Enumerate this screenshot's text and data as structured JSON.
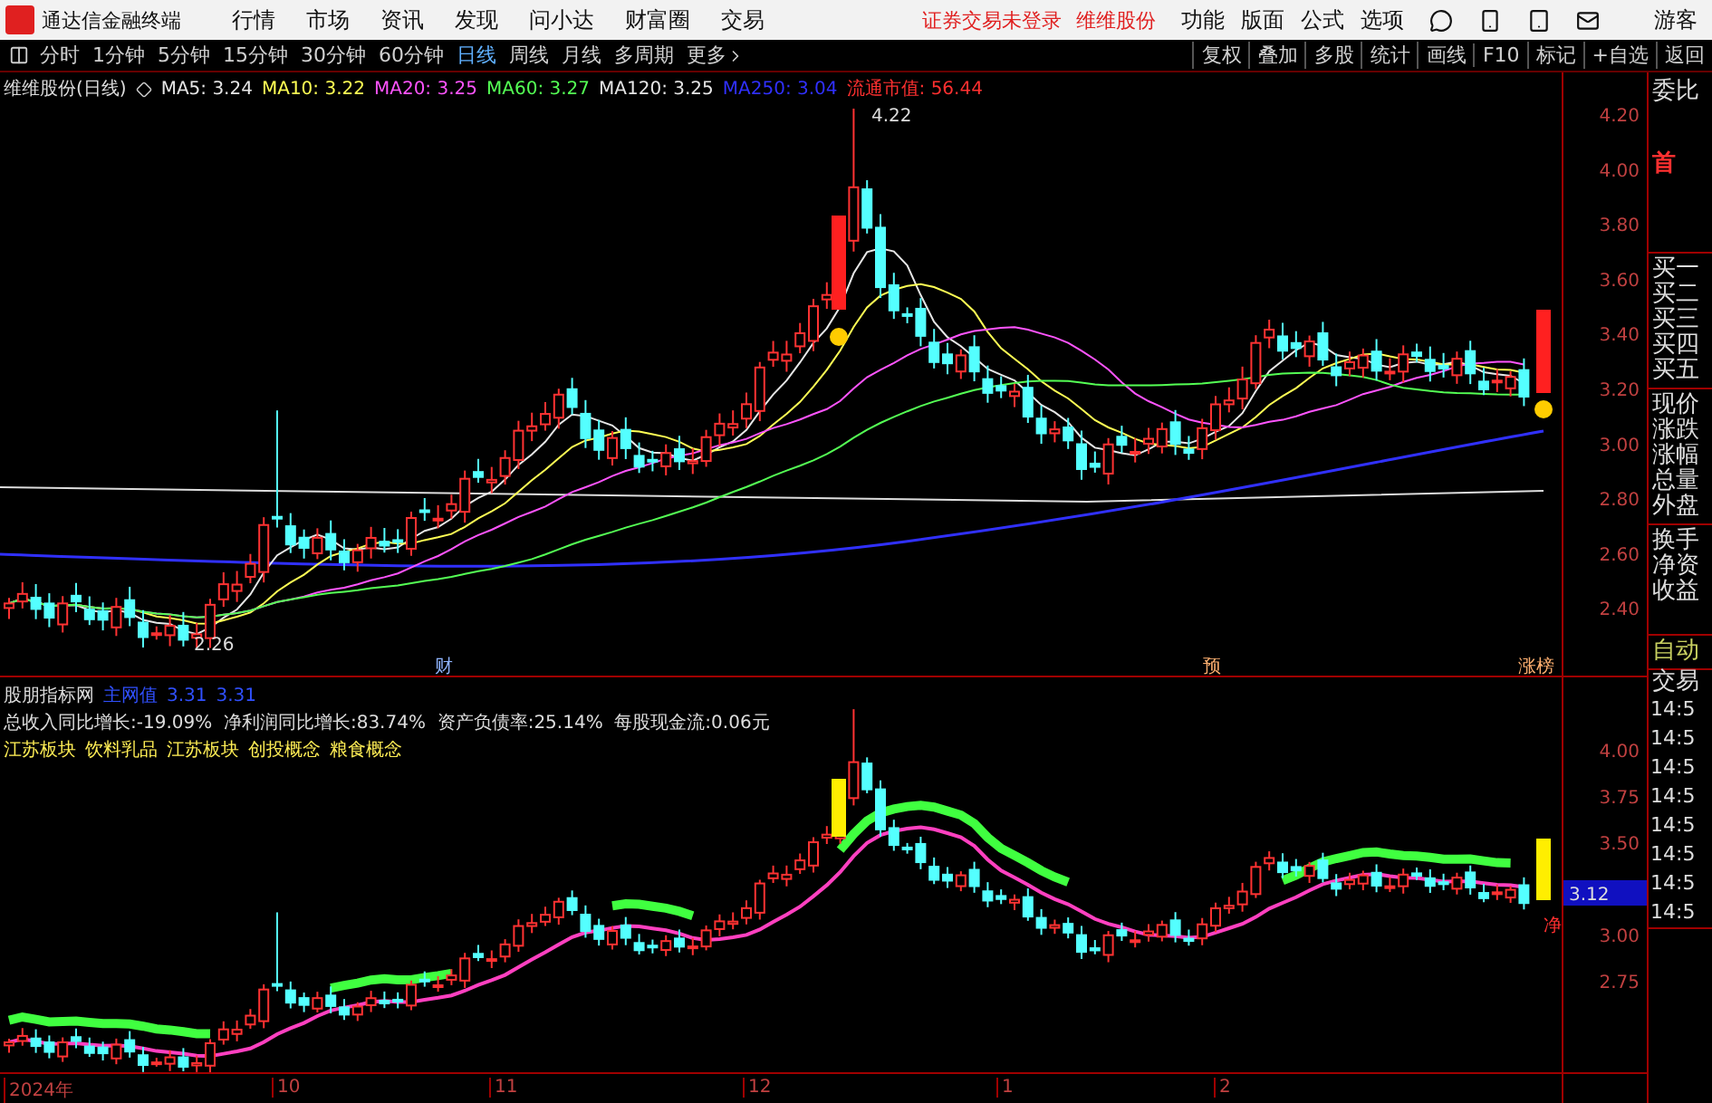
{
  "title_bar": {
    "app_name": "通达信金融终端",
    "menu": [
      "行情",
      "市场",
      "资讯",
      "发现",
      "问小达",
      "财富圈",
      "交易"
    ],
    "status": [
      "证券交易未登录",
      "维维股份"
    ],
    "tools": [
      "功能",
      "版面",
      "公式",
      "选项"
    ],
    "user": "游客"
  },
  "period_bar": {
    "periods": [
      {
        "label": "分时",
        "selected": false
      },
      {
        "label": "1分钟",
        "selected": false
      },
      {
        "label": "5分钟",
        "selected": false
      },
      {
        "label": "15分钟",
        "selected": false
      },
      {
        "label": "30分钟",
        "selected": false
      },
      {
        "label": "60分钟",
        "selected": false
      },
      {
        "label": "日线",
        "selected": true
      },
      {
        "label": "周线",
        "selected": false
      },
      {
        "label": "月线",
        "selected": false
      },
      {
        "label": "多周期",
        "selected": false
      },
      {
        "label": "更多",
        "selected": false
      }
    ],
    "actions": [
      "复权",
      "叠加",
      "多股",
      "统计",
      "画线",
      "F10",
      "标记",
      "+自选",
      "返回"
    ]
  },
  "main_chart": {
    "stock_title": "维维股份(日线)",
    "indicators": [
      {
        "label": "MA5: 3.24",
        "color": "#e6e6e6"
      },
      {
        "label": "MA10: 3.22",
        "color": "#ffff54"
      },
      {
        "label": "MA20: 3.25",
        "color": "#ff54ff"
      },
      {
        "label": "MA60: 3.27",
        "color": "#54ff54"
      },
      {
        "label": "MA120: 3.25",
        "color": "#e6e6e6"
      },
      {
        "label": "MA250: 3.04",
        "color": "#3030ff"
      }
    ],
    "market_cap": "流通市值: 56.44",
    "high_label": "4.22",
    "low_label": "2.26",
    "event_marks": [
      {
        "label": "财",
        "color": "#8fb4ff"
      },
      {
        "label": "预",
        "color": "#ffb070"
      },
      {
        "label": "涨榜",
        "color": "#ffb070"
      }
    ],
    "yticks": [
      "4.20",
      "4.00",
      "3.80",
      "3.60",
      "3.40",
      "3.20",
      "3.00",
      "2.80",
      "2.60",
      "2.40"
    ]
  },
  "indicator_panel": {
    "title": "股朋指标网",
    "line_name": "主网值",
    "values": [
      "3.31",
      "3.31"
    ],
    "stats": "总收入同比增长:-19.09%  净利润同比增长:83.74%  资产负债率:25.14%  每股现金流:0.06元",
    "concepts": [
      "江苏板块",
      "饮料乳品",
      "江苏板块",
      "创投概念",
      "粮食概念"
    ],
    "yticks": [
      "4.00",
      "3.75",
      "3.50",
      "3.00",
      "2.75"
    ],
    "current_price": "3.12",
    "signal": "净"
  },
  "x_axis": [
    "2024年",
    "10",
    "11",
    "12",
    "1",
    "2"
  ],
  "quote_panel": {
    "labels": [
      "委比"
    ],
    "highlight": "首",
    "book": [
      "买一",
      "买二",
      "买三",
      "买四",
      "买五"
    ],
    "quote": [
      "现价",
      "涨跌",
      "涨幅",
      "总量",
      "外盘"
    ],
    "stats": [
      "换手",
      "净资",
      "收益"
    ],
    "auto": "自动",
    "trade": "交易",
    "times": [
      "14:5",
      "14:5",
      "14:5",
      "14:5",
      "14:5",
      "14:5",
      "14:5",
      "14:5"
    ]
  }
}
